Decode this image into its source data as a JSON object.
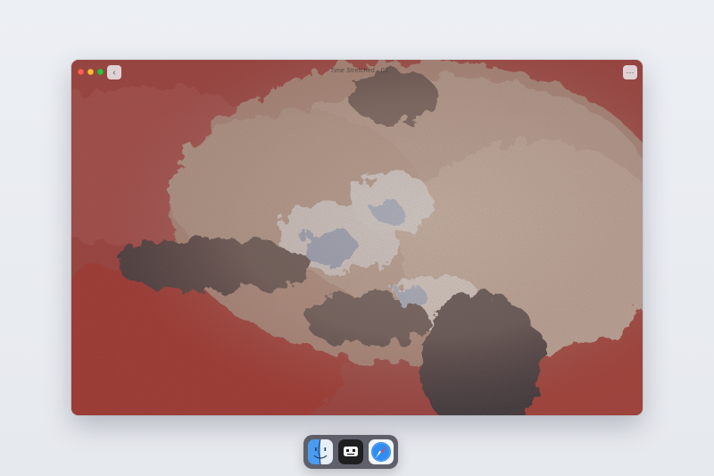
{
  "window": {
    "title": "Time Stretched · 02",
    "more_label": "···",
    "back_label": "‹"
  },
  "traffic_lights": {
    "close_color": "#ff5f57",
    "minimize_color": "#febc2e",
    "zoom_color": "#28c840"
  },
  "photo": {
    "palette": {
      "red": "#9c3f3a",
      "tan": "#b69b8c",
      "snow": "#dfe3ea",
      "shadow": "#3b3436",
      "blue_ice": "#8ea2c0"
    }
  },
  "dock": {
    "apps": [
      {
        "icon": "finder-icon"
      },
      {
        "icon": "robot-app-icon"
      },
      {
        "icon": "safari-icon"
      }
    ]
  }
}
